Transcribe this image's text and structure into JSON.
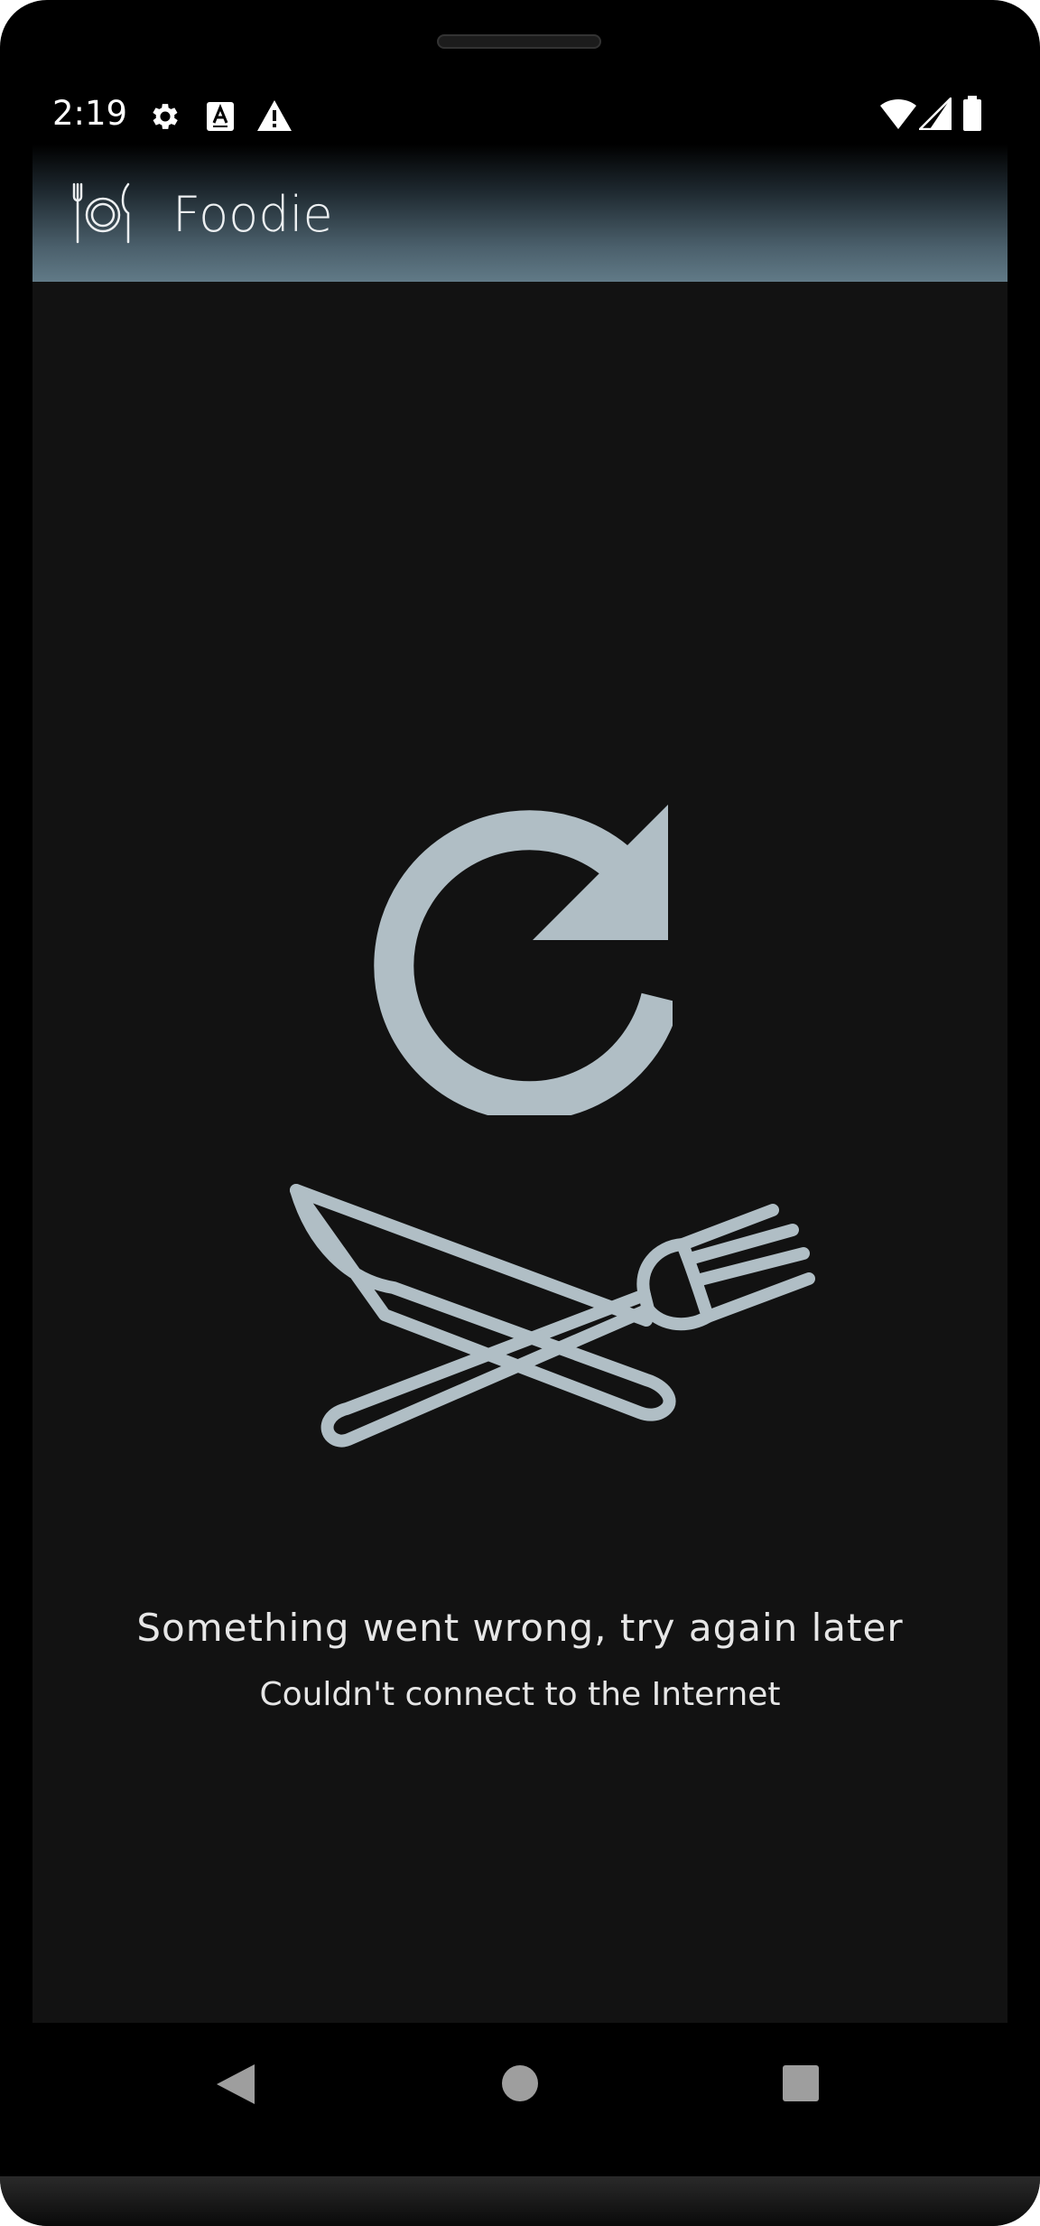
{
  "status_bar": {
    "time": "2:19",
    "icons": [
      "settings-icon",
      "keyboard-a-icon",
      "warning-icon",
      "wifi-icon",
      "signal-icon",
      "battery-icon"
    ]
  },
  "app_bar": {
    "title": "Foodie",
    "logo_icon": "plate-cutlery-icon"
  },
  "error_state": {
    "retry_icon": "refresh-icon",
    "illustration_icon": "crossed-knife-fork-icon",
    "title": "Something went wrong, try again later",
    "subtitle": "Couldn't connect to the Internet"
  },
  "nav_bar": {
    "buttons": [
      "back-icon",
      "home-icon",
      "recents-icon"
    ]
  },
  "colors": {
    "background": "#121212",
    "accent_icon": "#b0bec5",
    "text": "#e6e6e6",
    "app_bar_bottom": "#617a87"
  }
}
